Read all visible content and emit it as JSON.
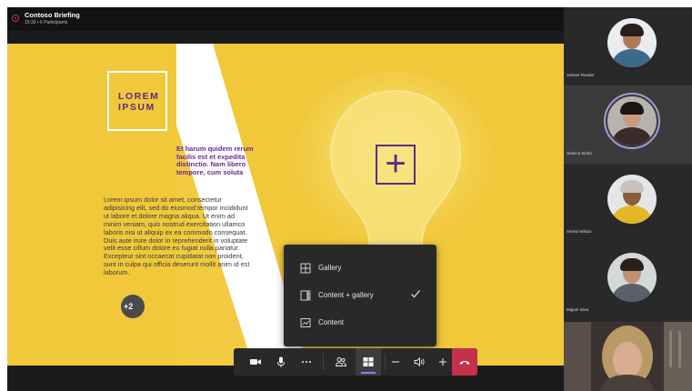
{
  "meeting": {
    "title": "Contoso Briefing",
    "subtitle": "15:33 • 6 Participants"
  },
  "slide": {
    "logo_text": "LOREM\nIPSUM",
    "highlight_text": "Et harum quidem rerum facilis est et expedita distinctio. Nam libero tempore, cum soluta",
    "body_text": "Lorem ipsum dolor sit amet, consectetur adipisicing elit, sed do eiusmod tempor incididunt ut labore et dolore magna aliqua. Ut enim ad minim veniam, quis nostrud exercitation ullamco laboris nisi ut aliquip ex ea commodo consequat. Duis aute irure dolor in reprehenderit in voluptate velit esse cillum dolore eu fugiat nulla pariatur. Excepteur sint occaecat cupidatat non proident, sunt in culpa qui officia deserunt mollit anim id est laborum.",
    "plus_symbol": "+"
  },
  "participants": [
    {
      "name": "Jaimee Reader",
      "skin": "#b07a56",
      "shirt": "#3a6b88",
      "hair": "#2a1f1a",
      "speaking": false
    },
    {
      "name": "Jessica Sinha",
      "skin": "#c89a7e",
      "shirt": "#3d2b2b",
      "hair": "#1c1512",
      "speaking": true
    },
    {
      "name": "Serina Wilson",
      "skin": "#8a5c42",
      "shirt": "#e3b824",
      "hair": "#c9c2bb",
      "speaking": false
    },
    {
      "name": "Miguel Silva",
      "skin": "#c09274",
      "shirt": "#5a6068",
      "hair": "#2b211c",
      "speaking": false
    }
  ],
  "more_participants": "+2",
  "layout_menu": {
    "items": [
      {
        "label": "Gallery",
        "icon": "gallery-icon",
        "selected": false
      },
      {
        "label": "Content + gallery",
        "icon": "content-gallery-icon",
        "selected": true
      },
      {
        "label": "Content",
        "icon": "content-icon",
        "selected": false
      }
    ]
  },
  "toolbar": {
    "buttons": [
      "camera-icon",
      "microphone-icon",
      "more-options-icon",
      "participants-icon",
      "layout-icon",
      "minus-icon",
      "speaker-icon",
      "plus-icon",
      "hang-up-icon"
    ]
  },
  "colors": {
    "slide_yellow": "#f0c83a",
    "accent_purple": "#5b2c83",
    "hangup_red": "#c4314b",
    "active_indicator": "#7f85f5"
  }
}
